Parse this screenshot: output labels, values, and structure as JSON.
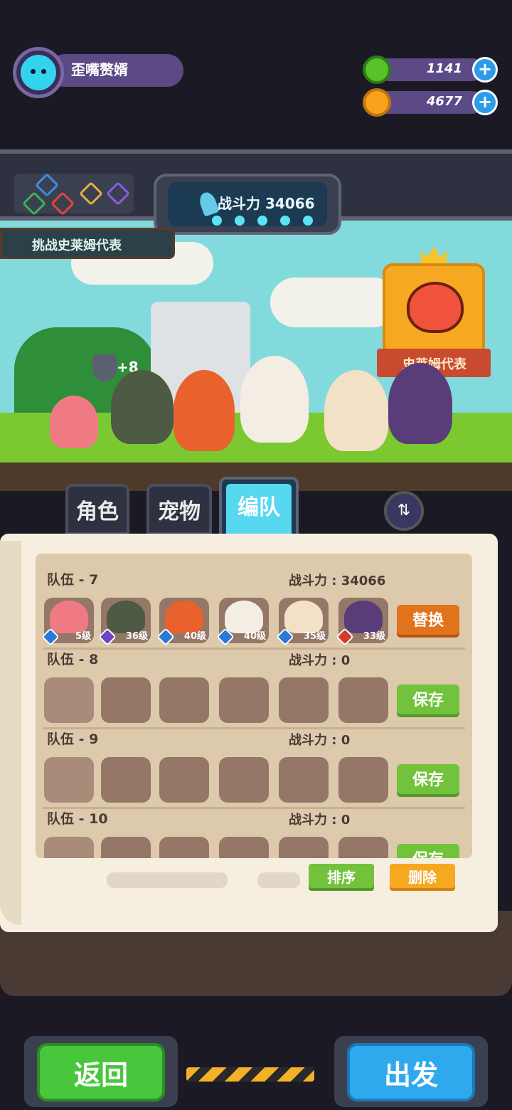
{
  "profile": {
    "name": "歪嘴赘婿",
    "avatar_icon": "cat-face-icon"
  },
  "resources": [
    {
      "name": "green-gem",
      "value": "1141",
      "color": "#59c12a"
    },
    {
      "name": "gold-coin",
      "value": "4677",
      "color": "#f6a21c"
    }
  ],
  "scene": {
    "power_label": "战斗力 34066",
    "challenge_label": "挑战史莱姆代表",
    "boss_banner": "史莱姆代表",
    "buff_text": "+8"
  },
  "tabs": [
    {
      "label": "角色"
    },
    {
      "label": "宠物"
    },
    {
      "label": "编队",
      "active": true
    }
  ],
  "teams": [
    {
      "name": "队伍 - 7",
      "power": "战斗力 : 34066",
      "action": "替换",
      "members": [
        {
          "level": "5级",
          "color": "#f07a84",
          "elem": "#2a79d6"
        },
        {
          "level": "36级",
          "color": "#4d5a44",
          "elem": "#6a47c0"
        },
        {
          "level": "40级",
          "color": "#e9612c",
          "elem": "#2a79d6"
        },
        {
          "level": "40级",
          "color": "#f3ede4",
          "elem": "#2a79d6"
        },
        {
          "level": "35级",
          "color": "#f2e0c7",
          "elem": "#2a79d6"
        },
        {
          "level": "33级",
          "color": "#5a3d78",
          "elem": "#d33a2a"
        }
      ]
    },
    {
      "name": "队伍 - 8",
      "power": "战斗力 : 0",
      "action": "保存"
    },
    {
      "name": "队伍 - 9",
      "power": "战斗力 : 0",
      "action": "保存"
    },
    {
      "name": "队伍 - 10",
      "power": "战斗力 : 0",
      "action": "保存"
    }
  ],
  "list_actions": {
    "sort": "排序",
    "delete": "删除"
  },
  "bottom": {
    "back": "返回",
    "go": "出发"
  }
}
